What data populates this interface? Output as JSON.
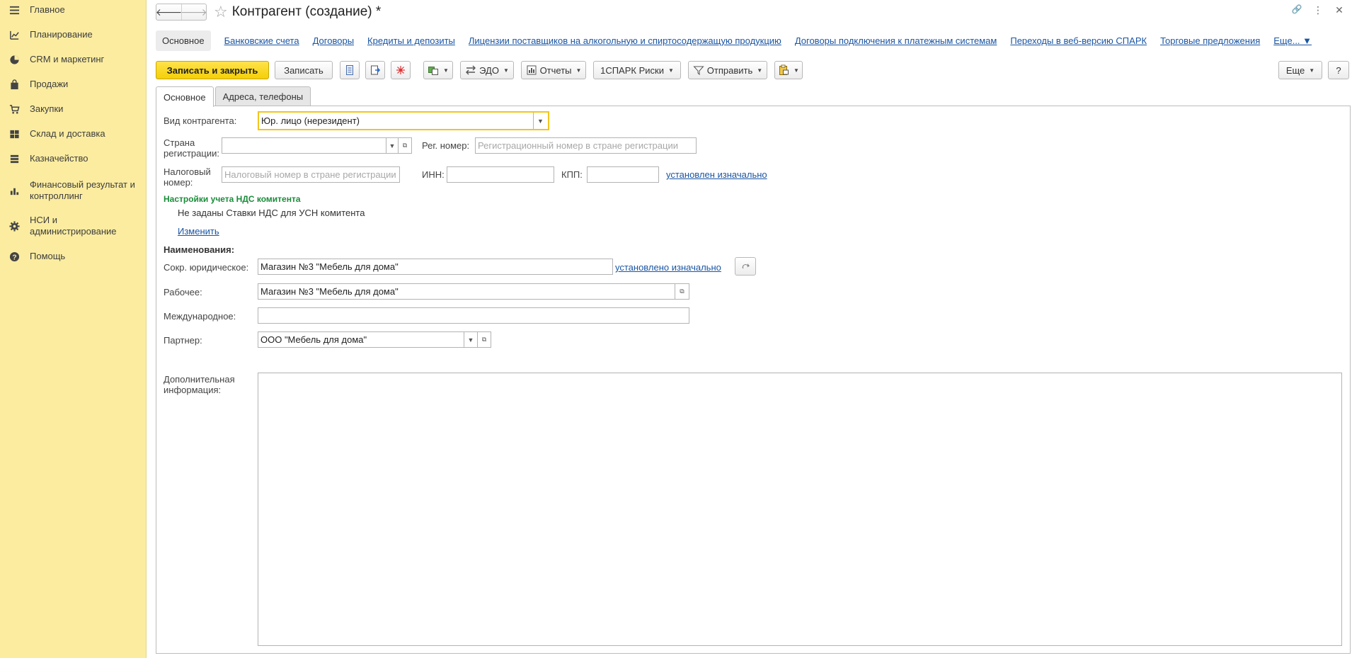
{
  "sidebar": {
    "items": [
      {
        "label": "Главное",
        "icon": "menu-icon"
      },
      {
        "label": "Планирование",
        "icon": "planning-icon"
      },
      {
        "label": "CRM и маркетинг",
        "icon": "pie-chart-icon"
      },
      {
        "label": "Продажи",
        "icon": "shopping-bag-icon"
      },
      {
        "label": "Закупки",
        "icon": "cart-icon"
      },
      {
        "label": "Склад и доставка",
        "icon": "warehouse-icon"
      },
      {
        "label": "Казначейство",
        "icon": "treasury-icon"
      },
      {
        "label": "Финансовый результат и контроллинг",
        "icon": "bar-chart-icon"
      },
      {
        "label": "НСИ и администрирование",
        "icon": "gear-icon"
      },
      {
        "label": "Помощь",
        "icon": "help-icon"
      }
    ]
  },
  "header": {
    "title": "Контрагент (создание) *",
    "back_glyph": "🡐",
    "forward_glyph": "🡒",
    "star_glyph": "☆",
    "link_glyph": "🔗",
    "more_glyph": "⋮",
    "close_glyph": "✕"
  },
  "linkbar": {
    "active": "Основное",
    "links": [
      "Банковские счета",
      "Договоры",
      "Кредиты и депозиты",
      "Лицензии поставщиков на алкогольную и спиртосодержащую продукцию",
      "Договоры подключения к платежным системам",
      "Переходы в веб-версию СПАРК",
      "Торговые предложения",
      "Еще... ▼"
    ]
  },
  "toolbar": {
    "save_close": "Записать и закрыть",
    "save": "Записать",
    "edo": "ЭДО",
    "reports": "Отчеты",
    "spark": "1СПАРК Риски",
    "send": "Отправить",
    "more": "Еще",
    "help": "?"
  },
  "tabs": [
    "Основное",
    "Адреса, телефоны"
  ],
  "form": {
    "kind_label": "Вид контрагента:",
    "kind_value": "Юр. лицо (нерезидент)",
    "country_label": "Страна регистрации:",
    "country_value": "",
    "reg_label": "Рег. номер:",
    "reg_placeholder": "Регистрационный номер в стране регистрации",
    "tax_label": "Налоговый номер:",
    "tax_placeholder": "Налоговый номер в стране регистрации",
    "inn_label": "ИНН:",
    "inn_value": "",
    "kpp_label": "КПП:",
    "kpp_value": "",
    "kpp_link": "установлен изначально",
    "vat_heading": "Настройки учета НДС комитента",
    "vat_text": "Не заданы Ставки НДС для УСН комитента",
    "vat_change": "Изменить",
    "names_heading": "Наименования:",
    "short_label": "Сокр. юридическое:",
    "short_value": "Магазин №3 \"Мебель для дома\"",
    "short_link": "установлено изначально",
    "work_label": "Рабочее:",
    "work_value": "Магазин №3 \"Мебель для дома\"",
    "intl_label": "Международное:",
    "intl_value": "",
    "partner_label": "Партнер:",
    "partner_value": "ООО \"Мебель для дома\"",
    "extra_label": "Дополнительная информация:",
    "extra_value": ""
  },
  "colors": {
    "sidebar_bg": "#fbeca0",
    "primary_btn": "#f4cf08",
    "link": "#1a55a3",
    "green_heading": "#1a8c3a",
    "focus_border": "#f2c51c"
  }
}
